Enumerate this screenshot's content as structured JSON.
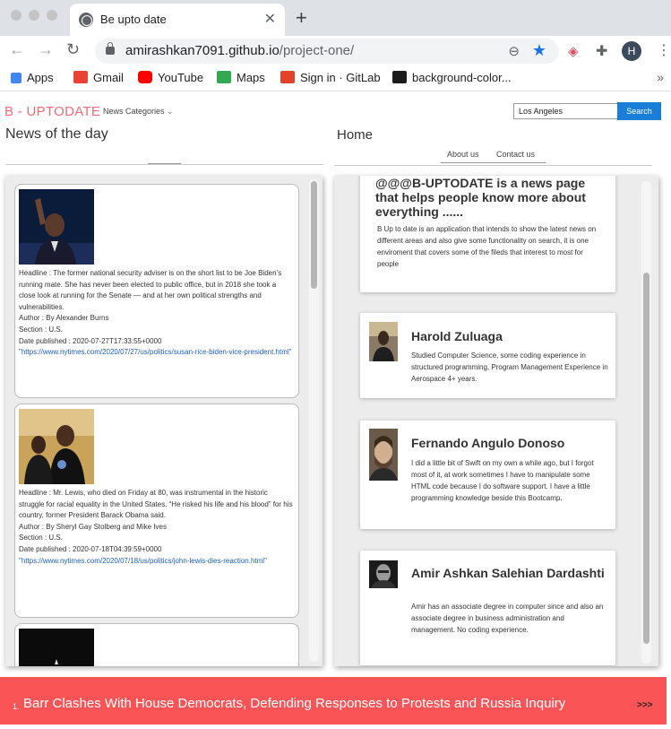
{
  "browser": {
    "tab_title": "Be upto date",
    "tab_close": "✕",
    "new_tab": "+",
    "url_host": "amirashkan7091.github.io",
    "url_path": "/project-one/",
    "avatar_letter": "H",
    "bookmarks": [
      {
        "label": "Apps",
        "icon": "apps-grid-icon",
        "color": "#4285f4"
      },
      {
        "label": "Gmail",
        "icon": "gmail-icon",
        "color": "#ea4335"
      },
      {
        "label": "YouTube",
        "icon": "youtube-icon",
        "color": "#ff0000"
      },
      {
        "label": "Maps",
        "icon": "maps-icon",
        "color": "#34a853"
      },
      {
        "label": "Sign in · GitLab",
        "icon": "gitlab-icon",
        "color": "#e24329"
      },
      {
        "label": "background-color...",
        "icon": "codepen-icon",
        "color": "#1b1b1b"
      }
    ],
    "bookmarks_more": "»"
  },
  "header": {
    "brand": "B - UPTODATE",
    "nav_categories": "News Categories",
    "search_value": "Los Angeles",
    "search_button": "Search"
  },
  "news_section": {
    "title": "News of the day",
    "cards": [
      {
        "headline": "Headline : The former national security adviser is on the short list to be Joe Biden’s running mate. She has never been elected to public office, but in 2018 she took a close look at running for the Senate — and at her own political strengths and vulnerabilities.",
        "author": "Author : By Alexander Burns",
        "section": "Section : U.S.",
        "date": "Date published : 2020-07-27T17:33:55+0000",
        "link": "\"https://www.nytimes.com/2020/07/27/us/politics/susan-rice-biden-vice-president.html\""
      },
      {
        "headline": "Headline : Mr. Lewis, who died on Friday at 80, was instrumental in the historic struggle for racial equality in the United States. “He risked his life and his blood” for his country, former President Barack Obama said.",
        "author": "Author : By Sheryl Gay Stolberg and Mike Ives",
        "section": "Section : U.S.",
        "date": "Date published : 2020-07-18T04:39:59+0000",
        "link": "\"https://www.nytimes.com/2020/07/18/us/politics/john-lewis-dies-reaction.html\""
      }
    ]
  },
  "home_section": {
    "title": "Home",
    "links": [
      "About us",
      "Contact us"
    ],
    "about_title": "@@@B-UPTODATE is a news page that helps people know more about everything ......",
    "about_text": "B Up to date is an application that intends to show the latest news on different areas and also give some functionality on search, it is one enviroment that covers some of the fileds that interest to most for people",
    "team": [
      {
        "name": "Harold Zuluaga",
        "bio": "Studied Computer Science, some coding experience in structured programming, Program Management Experience in Aerospace 4+ years."
      },
      {
        "name": "Fernando Angulo Donoso",
        "bio": "I did a little bit of Swift on my own a while ago, but I forgot most of it, at work sometimes I have to manipulate some HTML code because I do software support. I have a little programming knowledge beside this Bootcamp."
      },
      {
        "name": "Amir Ashkan Salehian Dardashti",
        "bio": "Amir has an associate degree in computer since and also an associate degree in business administration and management. No coding experience."
      }
    ]
  },
  "ticker": {
    "number": "1.",
    "text": "Barr Clashes With House Democrats, Defending Responses to Protests and Russia Inquiry",
    "more": ">>>",
    "color": "#fb5457"
  }
}
